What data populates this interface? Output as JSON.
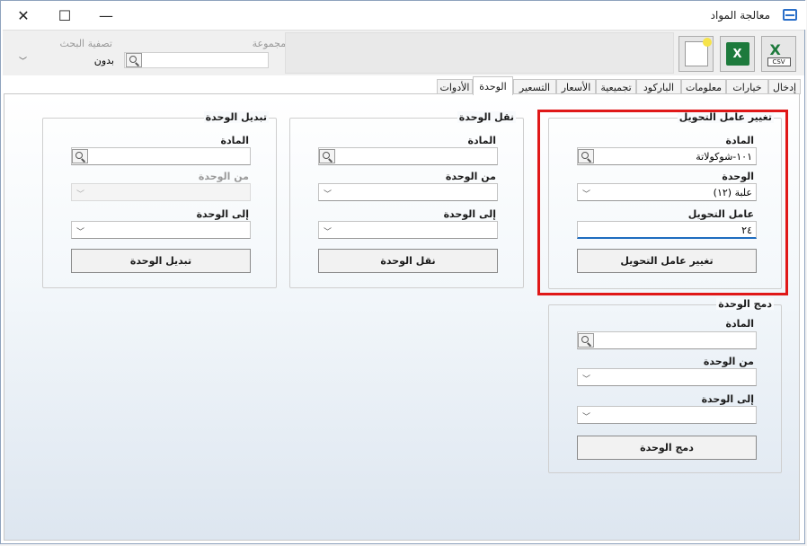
{
  "window": {
    "title": "معالجة المواد",
    "controls": {
      "close": "✕",
      "maximize": "☐",
      "minimize": "—"
    }
  },
  "toolbar": {
    "group_label": "المجموعة",
    "filter_label": "تصفية البحث",
    "filter_value": "بدون",
    "export_csv_caption": "CSV",
    "export_excel_caption": "X"
  },
  "tabs": [
    {
      "label": "إدخال"
    },
    {
      "label": "خيارات"
    },
    {
      "label": "معلومات"
    },
    {
      "label": "الباركود"
    },
    {
      "label": "تجميعية"
    },
    {
      "label": "الأسعار"
    },
    {
      "label": "التسعير"
    },
    {
      "label": "الوحدة"
    },
    {
      "label": "الأدوات"
    }
  ],
  "change_factor": {
    "title": "تغيير عامل التحويل",
    "material_label": "المادة",
    "material_value": "١٠١-شوكولاتة",
    "unit_label": "الوحدة",
    "unit_value": "علبة (١٢)",
    "factor_label": "عامل التحويل",
    "factor_value": "٢٤",
    "button": "تغيير عامل التحويل"
  },
  "move_unit": {
    "title": "نقل الوحدة",
    "material_label": "المادة",
    "from_label": "من الوحدة",
    "to_label": "إلى الوحدة",
    "button": "نقل الوحدة"
  },
  "swap_unit": {
    "title": "تبديل الوحدة",
    "material_label": "المادة",
    "from_label": "من الوحدة",
    "to_label": "إلى الوحدة",
    "button": "تبديل الوحدة"
  },
  "merge_unit": {
    "title": "دمج الوحدة",
    "material_label": "المادة",
    "from_label": "من الوحدة",
    "to_label": "إلى الوحدة",
    "button": "دمج الوحدة"
  },
  "colors": {
    "highlight": "#e01818",
    "focus": "#1e6cbf",
    "excel": "#1d7a3c"
  }
}
